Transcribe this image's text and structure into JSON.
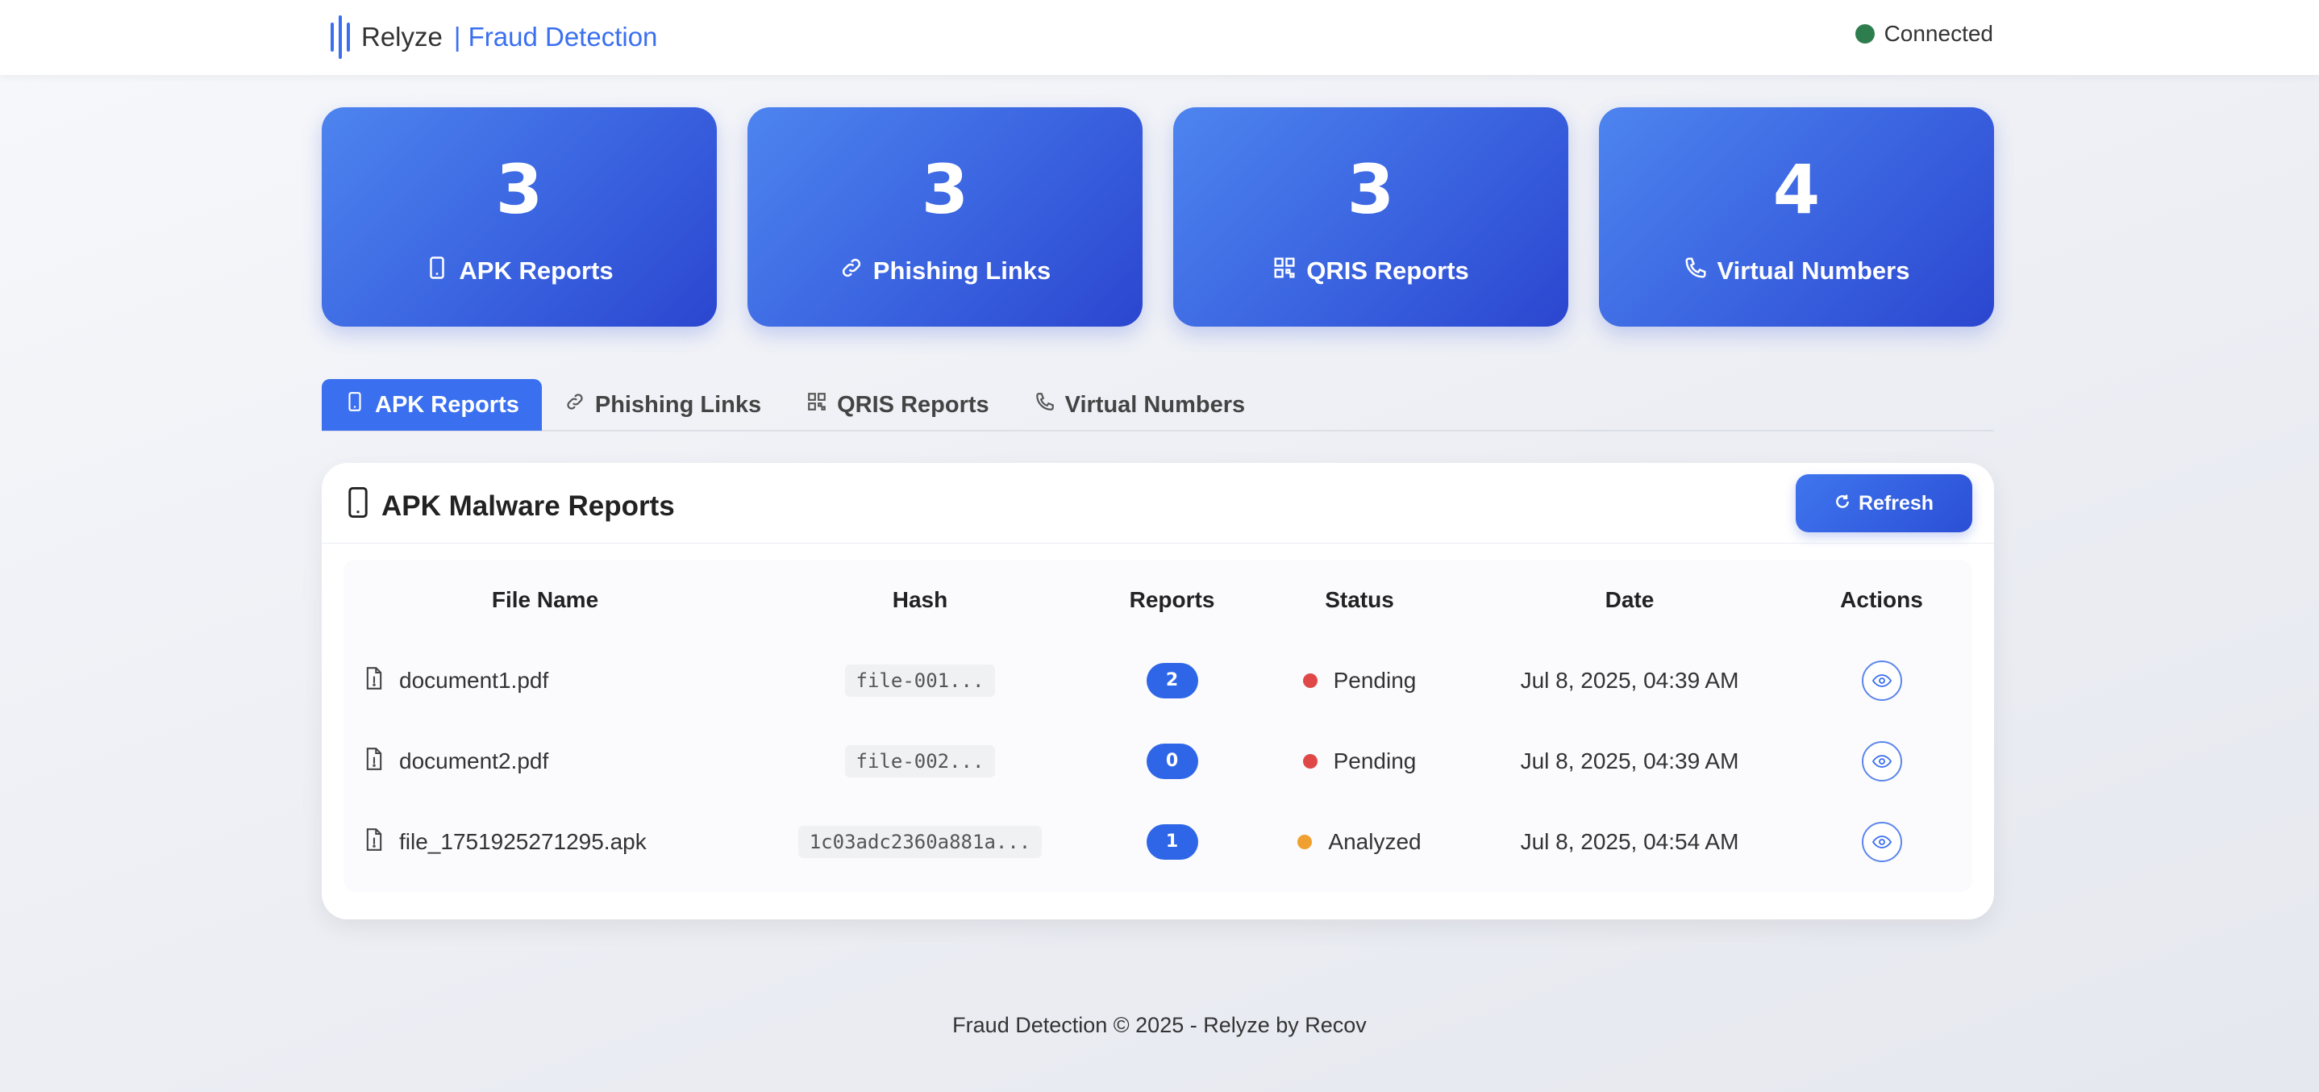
{
  "header": {
    "brand_name": "Relyze",
    "brand_sub": "| Fraud Detection",
    "connection_status": "Connected",
    "connection_color": "#2e7d4f"
  },
  "stats": [
    {
      "value": "3",
      "label": "APK Reports",
      "icon": "phone-icon"
    },
    {
      "value": "3",
      "label": "Phishing Links",
      "icon": "link-icon"
    },
    {
      "value": "3",
      "label": "QRIS Reports",
      "icon": "qr-code-icon"
    },
    {
      "value": "4",
      "label": "Virtual Numbers",
      "icon": "telephone-icon"
    }
  ],
  "tabs": [
    {
      "label": "APK Reports",
      "active": true
    },
    {
      "label": "Phishing Links",
      "active": false
    },
    {
      "label": "QRIS Reports",
      "active": false
    },
    {
      "label": "Virtual Numbers",
      "active": false
    }
  ],
  "panel": {
    "title": "APK Malware Reports",
    "refresh_label": "Refresh"
  },
  "table": {
    "columns": [
      "File Name",
      "Hash",
      "Reports",
      "Status",
      "Date",
      "Actions"
    ],
    "rows": [
      {
        "file": "document1.pdf",
        "hash": "file-001...",
        "reports": "2",
        "status": "Pending",
        "status_color": "#e04848",
        "date": "Jul 8, 2025, 04:39 AM"
      },
      {
        "file": "document2.pdf",
        "hash": "file-002...",
        "reports": "0",
        "status": "Pending",
        "status_color": "#e04848",
        "date": "Jul 8, 2025, 04:39 AM"
      },
      {
        "file": "file_1751925271295.apk",
        "hash": "1c03adc2360a881a...",
        "reports": "1",
        "status": "Analyzed",
        "status_color": "#f0a030",
        "date": "Jul 8, 2025, 04:54 AM"
      }
    ]
  },
  "footer": {
    "text": "Fraud Detection © 2025 - Relyze by Recov"
  },
  "colors": {
    "accent": "#3a6ff0",
    "card_gradient_start": "#4d84ef",
    "card_gradient_end": "#2b46cf"
  }
}
